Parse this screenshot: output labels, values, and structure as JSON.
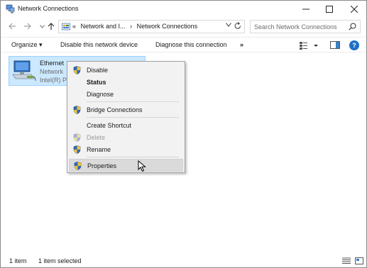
{
  "window": {
    "title": "Network Connections",
    "icon": "network-connections-icon"
  },
  "address": {
    "crumbs": [
      "«",
      "Network and I...",
      "›",
      "Network Connections"
    ]
  },
  "search": {
    "placeholder": "Search Network Connections"
  },
  "toolbar": {
    "organize_label": "Organize ▾",
    "disable_label": "Disable this network device",
    "diagnose_label": "Diagnose this connection",
    "more_label": "»",
    "help_label": "?"
  },
  "item": {
    "name": "Ethernet",
    "status": "Network",
    "adapter": "Intel(R) P",
    "icon": "ethernet-adapter-icon"
  },
  "context_menu": {
    "items": [
      {
        "label": "Disable",
        "shield": true,
        "bold": false,
        "disabled": false
      },
      {
        "label": "Status",
        "shield": false,
        "bold": true,
        "disabled": false
      },
      {
        "label": "Diagnose",
        "shield": false,
        "bold": false,
        "disabled": false
      },
      {
        "label": "Bridge Connections",
        "shield": true,
        "bold": false,
        "disabled": false
      },
      {
        "label": "Create Shortcut",
        "shield": false,
        "bold": false,
        "disabled": false
      },
      {
        "label": "Delete",
        "shield": true,
        "bold": false,
        "disabled": true
      },
      {
        "label": "Rename",
        "shield": true,
        "bold": false,
        "disabled": false
      },
      {
        "label": "Properties",
        "shield": true,
        "bold": false,
        "disabled": false,
        "highlighted": true
      }
    ]
  },
  "status": {
    "count": "1 item",
    "selected": "1 item selected"
  },
  "colors": {
    "selection_bg": "#cce8ff",
    "selection_border": "#99d1ff",
    "help_blue": "#1f6fc4",
    "menu_bg": "#f2f2f2",
    "menu_highlight": "#dadada"
  }
}
